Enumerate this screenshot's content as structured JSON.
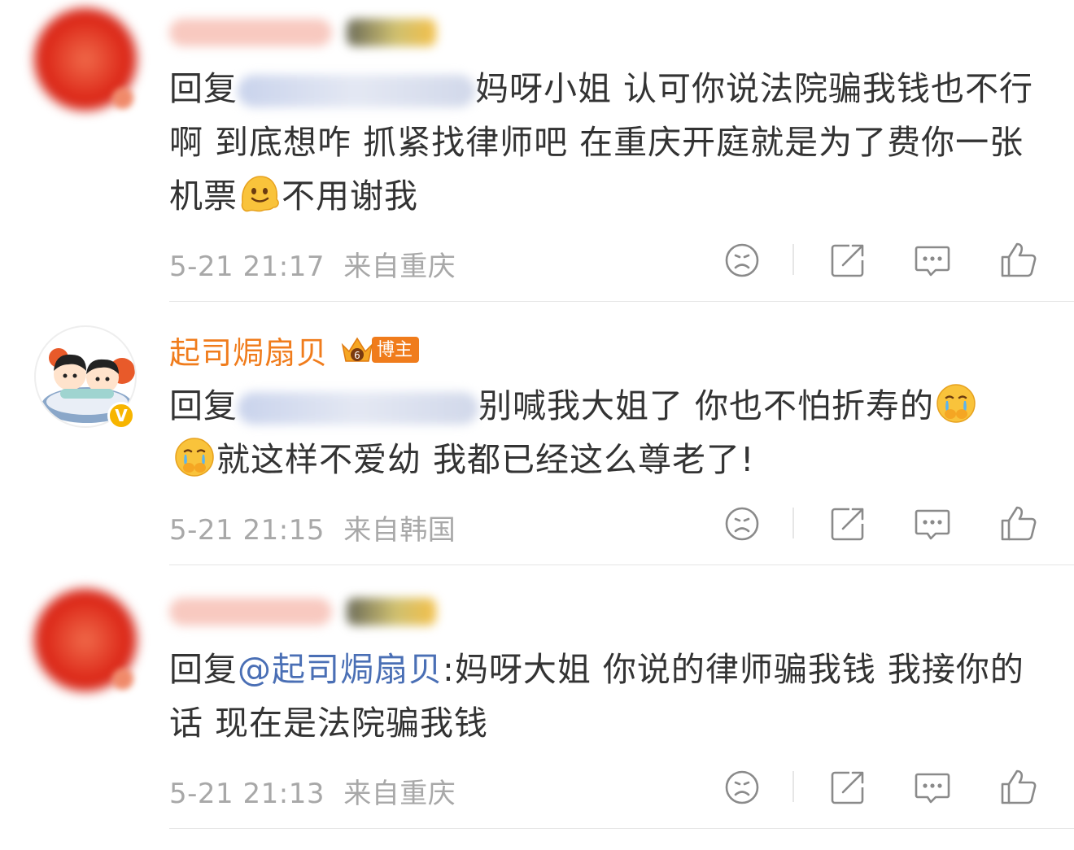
{
  "comments": [
    {
      "reply_prefix": "回复",
      "text_after_mention": "妈呀小姐  认可你说法院骗我钱也不行啊 到底想咋 抓紧找律师吧 在重庆开庭就是为了费你一张机票",
      "text_after_emoji": "不用谢我",
      "emoji": "melting-face",
      "time": "5-21 21:17",
      "location": "来自重庆"
    },
    {
      "username": "起司焗扇贝",
      "badge_label": "博主",
      "badge_level": "6",
      "verified_mark": "V",
      "reply_prefix": "回复",
      "text_after_mention": "别喊我大姐了 你也不怕折寿的",
      "text_line2": "就这样不爱幼 我都已经这么尊老了!",
      "emoji": "crying-covering-mouth-face",
      "time": "5-21 21:15",
      "location": "来自韩国"
    },
    {
      "reply_prefix": "回复",
      "mention": "@起司焗扇贝",
      "text_after_mention": ":妈呀大姐  你说的律师骗我钱 我接你的话 现在是法院骗我钱",
      "time": "5-21 21:13",
      "location": "来自重庆"
    }
  ],
  "action_icons": [
    "dislike-icon",
    "share-icon",
    "comment-icon",
    "like-icon"
  ],
  "colors": {
    "username": "#f07c1c",
    "mention": "#4a6fb5",
    "body_text": "#333333",
    "meta_text": "#a8a8a8",
    "divider": "#e5e5e5"
  }
}
